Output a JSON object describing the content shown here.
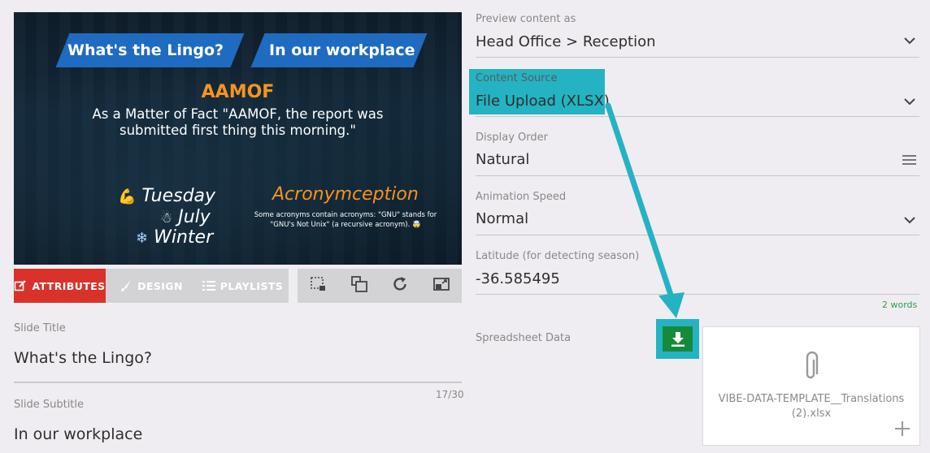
{
  "preview": {
    "banner_left": "What's the Lingo?",
    "banner_right": "In our workplace",
    "acronym": "AAMOF",
    "definition": "As a Matter of Fact \"AAMOF, the report was submitted first thing this morning.\"",
    "day": "Tuesday",
    "month": "July",
    "season": "Winter",
    "section_title": "Acronymception",
    "section_text": "Some acronyms contain acronyms: \"GNU\" stands for \"GNU's Not Unix\" (a recursive acronym). 🤯"
  },
  "tabs": [
    {
      "label": "ATTRIBUTES",
      "active": true
    },
    {
      "label": "DESIGN",
      "active": false
    },
    {
      "label": "PLAYLISTS",
      "active": false
    }
  ],
  "tools": [
    "crop-icon",
    "layers-icon",
    "refresh-icon",
    "resize-icon"
  ],
  "left_form": {
    "slide_title_label": "Slide Title",
    "slide_title_value": "What's the Lingo?",
    "char_count": "17/30",
    "slide_subtitle_label": "Slide Subtitle",
    "slide_subtitle_value": "In our workplace"
  },
  "right_form": {
    "preview_as_label": "Preview content as",
    "preview_as_value": "Head Office > Reception",
    "content_source_label": "Content Source",
    "content_source_value": "File Upload (XLSX)",
    "display_order_label": "Display Order",
    "display_order_value": "Natural",
    "animation_speed_label": "Animation Speed",
    "animation_speed_value": "Normal",
    "latitude_label": "Latitude (for detecting season)",
    "latitude_value": "-36.585495",
    "word_count": "2 words",
    "spreadsheet_label": "Spreadsheet Data",
    "file_name": "VIBE-DATA-TEMPLATE__Translations (2).xlsx"
  },
  "colors": {
    "accent_red": "#d9322b",
    "highlight": "#24b3c2",
    "download_green": "#178a3a",
    "banner_blue": "#1e6bc1",
    "acronym_orange": "#f7941d"
  }
}
